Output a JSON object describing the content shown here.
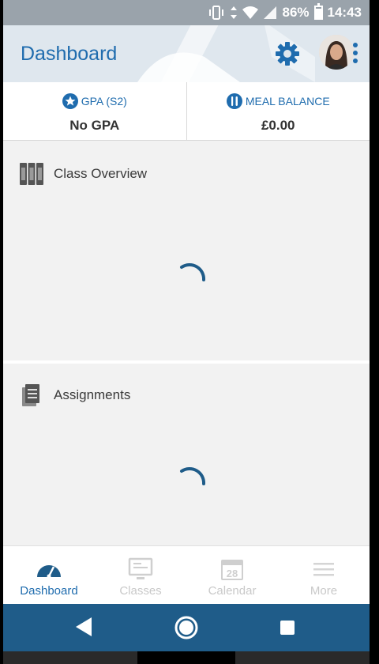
{
  "status_bar": {
    "battery_percent": "86%",
    "time": "14:43"
  },
  "header": {
    "title": "Dashboard"
  },
  "info": {
    "gpa_label": "GPA (S2)",
    "gpa_value": "No GPA",
    "meal_label": "MEAL BALANCE",
    "meal_value": "£0.00"
  },
  "cards": {
    "class_overview": "Class Overview",
    "assignments": "Assignments"
  },
  "bottom_nav": {
    "tabs": [
      {
        "label": "Dashboard",
        "icon": "speedometer-icon",
        "active": true
      },
      {
        "label": "Classes",
        "icon": "monitor-icon",
        "active": false
      },
      {
        "label": "Calendar",
        "icon": "calendar-icon",
        "active": false,
        "badge": "28"
      },
      {
        "label": "More",
        "icon": "menu-icon",
        "active": false
      }
    ]
  },
  "colors": {
    "primary": "#1f6cae",
    "system_nav": "#1f5c89",
    "inactive": "#c9c9c9"
  }
}
